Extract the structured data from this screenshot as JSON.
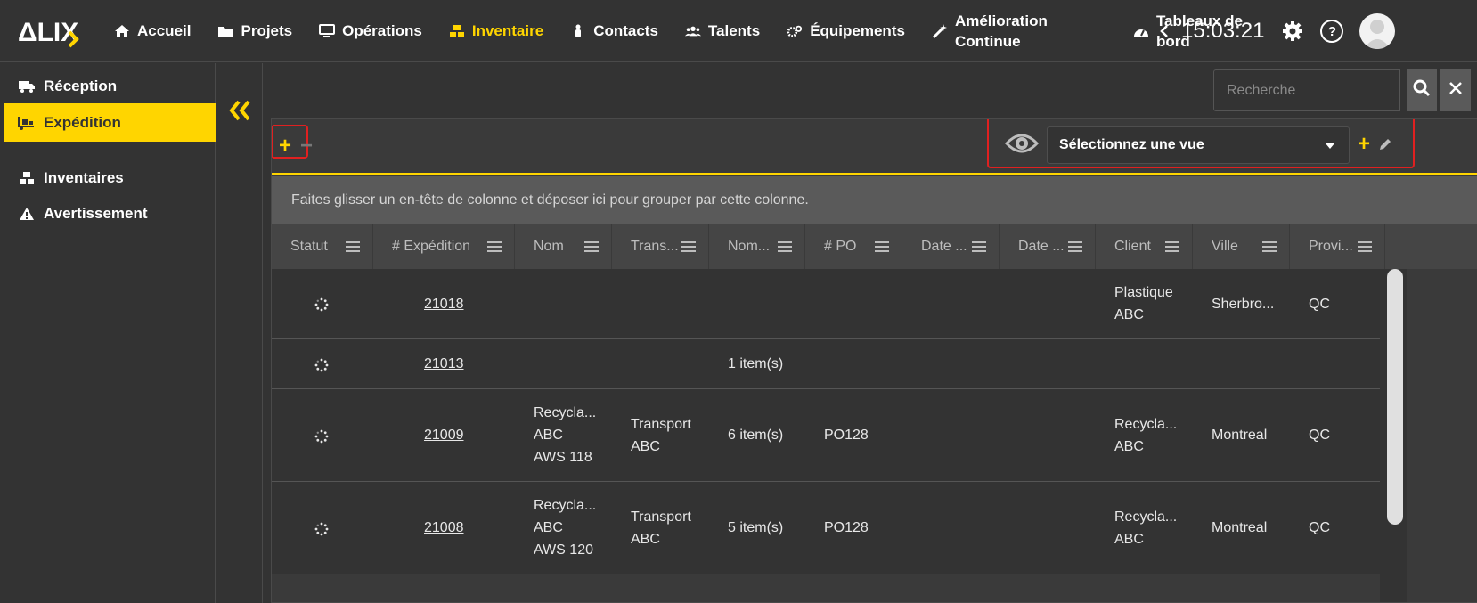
{
  "nav": {
    "items": [
      {
        "label": "Accueil",
        "icon": "home-icon"
      },
      {
        "label": "Projets",
        "icon": "folder-icon"
      },
      {
        "label": "Opérations",
        "icon": "monitor-icon"
      },
      {
        "label": "Inventaire",
        "icon": "cubes-icon",
        "active": true
      },
      {
        "label": "Contacts",
        "icon": "person-icon"
      },
      {
        "label": "Talents",
        "icon": "users-icon"
      },
      {
        "label": "Équipements",
        "icon": "cogs-icon"
      },
      {
        "label": "Amélioration Continue",
        "icon": "magic-wand-icon"
      },
      {
        "label": "Tableaux de bord",
        "icon": "gauge-icon"
      }
    ],
    "clock": "15:03:21",
    "help": "?"
  },
  "sidebar": {
    "items": [
      {
        "label": "Réception",
        "icon": "truck-icon"
      },
      {
        "label": "Expédition",
        "icon": "truck-loading-icon",
        "active": true
      },
      {
        "label": "Inventaires",
        "icon": "cubes-icon"
      },
      {
        "label": "Avertissement",
        "icon": "warning-icon"
      }
    ]
  },
  "search": {
    "placeholder": "Recherche"
  },
  "toolbar": {
    "add": "+",
    "remove": "−",
    "view_placeholder": "Sélectionnez une vue",
    "add_view": "+"
  },
  "grid": {
    "group_hint": "Faites glisser un en-tête de colonne et déposer ici pour grouper par cette colonne.",
    "columns": [
      "Statut",
      "# Expédition",
      "Nom",
      "Trans...",
      "Nom...",
      "# PO",
      "Date ...",
      "Date ...",
      "Client",
      "Ville",
      "Provi..."
    ],
    "rows": [
      {
        "expedition": "21018",
        "nom": "",
        "transport": "",
        "nom_items": "",
        "po": "",
        "client": "Plastique ABC",
        "ville": "Sherbro...",
        "province": "QC"
      },
      {
        "expedition": "21013",
        "nom": "",
        "transport": "",
        "nom_items": "1 item(s)",
        "po": "",
        "client": "",
        "ville": "",
        "province": ""
      },
      {
        "expedition": "21009",
        "nom": "Recycla... ABC AWS 118",
        "transport": "Transport ABC",
        "nom_items": "6 item(s)",
        "po": "PO128",
        "client": "Recycla... ABC",
        "ville": "Montreal",
        "province": "QC"
      },
      {
        "expedition": "21008",
        "nom": "Recycla... ABC AWS 120",
        "transport": "Transport ABC",
        "nom_items": "5 item(s)",
        "po": "PO128",
        "client": "Recycla... ABC",
        "ville": "Montreal",
        "province": "QC"
      }
    ]
  },
  "colors": {
    "accent": "#ffd500",
    "background": "#333333",
    "annotation": "#e02020"
  }
}
